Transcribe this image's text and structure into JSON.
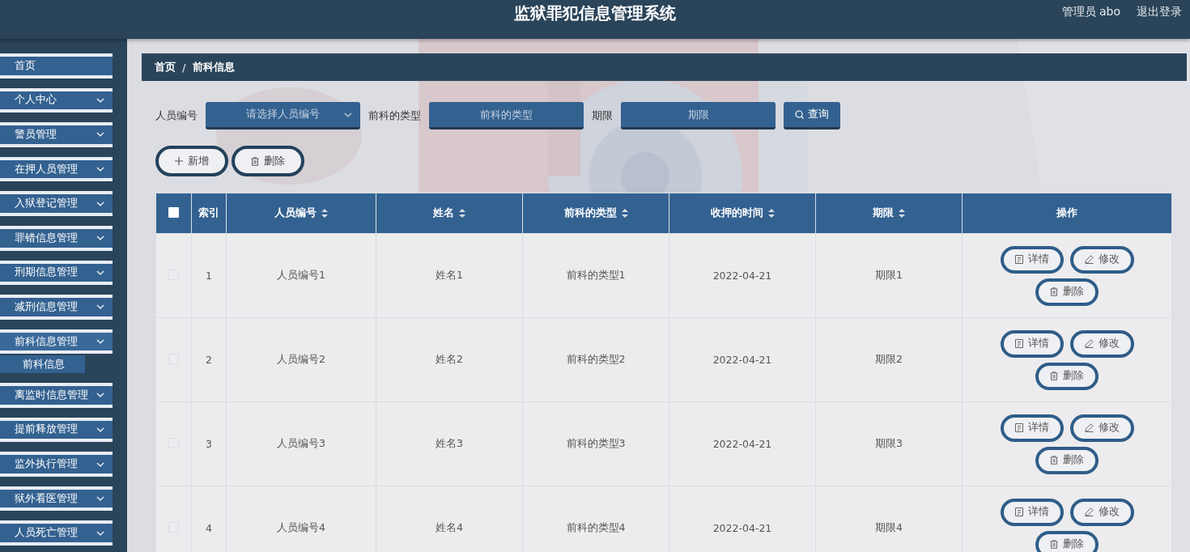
{
  "header": {
    "title": "监狱罪犯信息管理系统",
    "user": "管理员 abo",
    "logout": "退出登录"
  },
  "sidebar": {
    "items": [
      {
        "label": "首页",
        "expandable": false,
        "expanded": false
      },
      {
        "label": "个人中心",
        "expandable": true,
        "expanded": false
      },
      {
        "label": "警员管理",
        "expandable": true,
        "expanded": false
      },
      {
        "label": "在押人员管理",
        "expandable": true,
        "expanded": false
      },
      {
        "label": "入狱登记管理",
        "expandable": true,
        "expanded": false
      },
      {
        "label": "罪错信息管理",
        "expandable": true,
        "expanded": false
      },
      {
        "label": "刑期信息管理",
        "expandable": true,
        "expanded": false
      },
      {
        "label": "减刑信息管理",
        "expandable": true,
        "expanded": false
      },
      {
        "label": "前科信息管理",
        "expandable": true,
        "expanded": true,
        "children": [
          {
            "label": "前科信息"
          }
        ]
      },
      {
        "label": "离监时信息管理",
        "expandable": true,
        "expanded": false
      },
      {
        "label": "提前释放管理",
        "expandable": true,
        "expanded": false
      },
      {
        "label": "监外执行管理",
        "expandable": true,
        "expanded": false
      },
      {
        "label": "狱外看医管理",
        "expandable": true,
        "expanded": false
      },
      {
        "label": "人员死亡管理",
        "expandable": true,
        "expanded": false
      }
    ]
  },
  "breadcrumb": {
    "items": [
      "首页",
      "前科信息"
    ],
    "separator": "/"
  },
  "search": {
    "fields": [
      {
        "label": "人员编号",
        "placeholder": "请选择人员编号",
        "kind": "select"
      },
      {
        "label": "前科的类型",
        "placeholder": "前科的类型",
        "kind": "input"
      },
      {
        "label": "期限",
        "placeholder": "期限",
        "kind": "input"
      }
    ],
    "button": "查询"
  },
  "actions": [
    {
      "label": "新增",
      "kind": "add"
    },
    {
      "label": "删除",
      "kind": "delete"
    }
  ],
  "table": {
    "header_checked": false,
    "columns": [
      {
        "label": "索引",
        "sortable": false
      },
      {
        "label": "人员编号",
        "sortable": true
      },
      {
        "label": "姓名",
        "sortable": true
      },
      {
        "label": "前科的类型",
        "sortable": true
      },
      {
        "label": "收押的时间",
        "sortable": true
      },
      {
        "label": "期限",
        "sortable": true
      },
      {
        "label": "操作",
        "sortable": false
      }
    ],
    "rows": [
      {
        "checked": false,
        "cells": [
          "1",
          "人员编号1",
          "姓名1",
          "前科的类型1",
          "2022-04-21",
          "期限1"
        ],
        "actions": [
          {
            "label": "详情",
            "kind": "detail"
          },
          {
            "label": "修改",
            "kind": "edit"
          },
          {
            "label": "删除",
            "kind": "delete"
          }
        ]
      },
      {
        "checked": false,
        "cells": [
          "2",
          "人员编号2",
          "姓名2",
          "前科的类型2",
          "2022-04-21",
          "期限2"
        ],
        "actions": [
          {
            "label": "详情",
            "kind": "detail"
          },
          {
            "label": "修改",
            "kind": "edit"
          },
          {
            "label": "删除",
            "kind": "delete"
          }
        ]
      },
      {
        "checked": false,
        "cells": [
          "3",
          "人员编号3",
          "姓名3",
          "前科的类型3",
          "2022-04-21",
          "期限3"
        ],
        "actions": [
          {
            "label": "详情",
            "kind": "detail"
          },
          {
            "label": "修改",
            "kind": "edit"
          },
          {
            "label": "删除",
            "kind": "delete"
          }
        ]
      },
      {
        "checked": false,
        "cells": [
          "4",
          "人员编号4",
          "姓名4",
          "前科的类型4",
          "2022-04-21",
          "期限4"
        ],
        "actions": [
          {
            "label": "详情",
            "kind": "detail"
          },
          {
            "label": "修改",
            "kind": "edit"
          },
          {
            "label": "删除",
            "kind": "delete"
          }
        ]
      }
    ]
  }
}
